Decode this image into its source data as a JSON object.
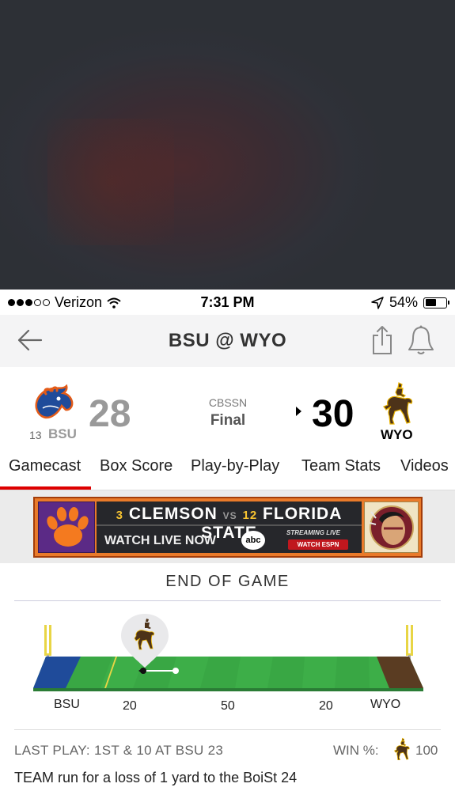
{
  "status_bar": {
    "carrier": "Verizon",
    "time": "7:31 PM",
    "battery": "54%",
    "battery_level": 0.54,
    "signal_bars_filled": 3,
    "signal_bars_total": 5,
    "icons": [
      "wifi-icon",
      "location-arrow-icon",
      "battery-icon"
    ]
  },
  "nav": {
    "title": "BSU @ WYO",
    "icons": [
      "back-arrow-icon",
      "share-icon",
      "bell-icon"
    ]
  },
  "scoreboard": {
    "away": {
      "abbr": "BSU",
      "rank": "13",
      "score": "28",
      "color": "#1f4b9a",
      "accent": "#e35b18"
    },
    "home": {
      "abbr": "WYO",
      "score": "30",
      "color": "#4d3319",
      "accent": "#e8b200"
    },
    "network": "CBSSN",
    "status": "Final"
  },
  "tabs": [
    {
      "label": "Gamecast",
      "active": true
    },
    {
      "label": "Box Score"
    },
    {
      "label": "Play-by-Play"
    },
    {
      "label": "Team Stats"
    },
    {
      "label": "Videos"
    }
  ],
  "ad": {
    "rank1": "3",
    "team1": "CLEMSON",
    "vs": "VS",
    "rank2": "12",
    "team2": "FLORIDA STATE",
    "cta": "WATCH LIVE NOW",
    "network": "abc",
    "streaming": "STREAMING LIVE",
    "watch": "WATCH ESPN",
    "icons": [
      "clemson-paw-logo",
      "fsu-seminole-logo"
    ]
  },
  "game": {
    "end_label": "END OF GAME",
    "field": {
      "left_endzone": "BSU",
      "right_endzone": "WYO",
      "yard_labels": [
        "20",
        "50",
        "20"
      ],
      "left_endzone_color": "#1f4b9a",
      "right_endzone_color": "#5a3c22",
      "field_color": "#3dae48"
    },
    "last_play": {
      "label": "LAST PLAY: 1ST & 10 AT BSU 23",
      "win_label": "WIN %:",
      "win_value": "100",
      "text": "TEAM run for a loss of 1 yard to the BoiSt 24"
    }
  }
}
